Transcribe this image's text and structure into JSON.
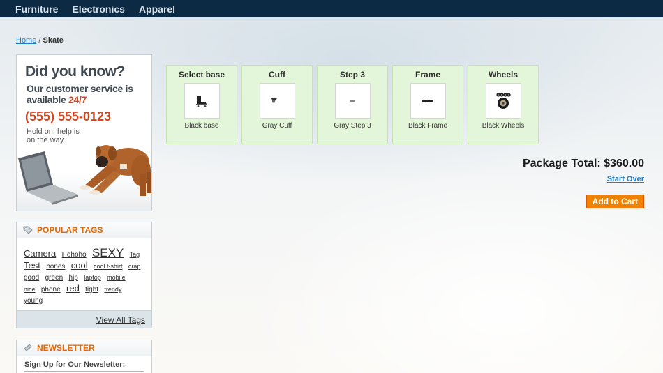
{
  "nav": {
    "items": [
      "Furniture",
      "Electronics",
      "Apparel"
    ]
  },
  "breadcrumb": {
    "home": "Home",
    "separator": " / ",
    "current": "Skate"
  },
  "callout": {
    "title": "Did you know?",
    "line1": "Our customer service is",
    "line2_prefix": "available ",
    "line2_highlight": "24/7",
    "phone": "(555) 555-0123",
    "hold": "Hold on, help is on the way."
  },
  "tags_block": {
    "title": "POPULAR TAGS",
    "icon": "tag-icon",
    "tags": [
      {
        "label": "Camera",
        "size": 13
      },
      {
        "label": "Hohoho",
        "size": 10
      },
      {
        "label": "SEXY",
        "size": 17
      },
      {
        "label": "Tag",
        "size": 9
      },
      {
        "label": "Test",
        "size": 13
      },
      {
        "label": "bones",
        "size": 10
      },
      {
        "label": "cool",
        "size": 13
      },
      {
        "label": "cool t-shirt",
        "size": 9
      },
      {
        "label": "crap",
        "size": 9
      },
      {
        "label": "good",
        "size": 10
      },
      {
        "label": "green",
        "size": 10
      },
      {
        "label": "hip",
        "size": 10
      },
      {
        "label": "laptop",
        "size": 9
      },
      {
        "label": "mobile",
        "size": 9
      },
      {
        "label": "nice",
        "size": 9
      },
      {
        "label": "phone",
        "size": 10
      },
      {
        "label": "red",
        "size": 13
      },
      {
        "label": "tight",
        "size": 10
      },
      {
        "label": "trendy",
        "size": 9
      },
      {
        "label": "young",
        "size": 10
      }
    ],
    "view_all": "View All Tags"
  },
  "newsletter": {
    "title": "NEWSLETTER",
    "icon": "newsletter-icon",
    "label": "Sign Up for Our Newsletter:"
  },
  "bundle": {
    "steps": [
      {
        "title": "Select base",
        "name": "Black base",
        "icon": "skate-base-icon"
      },
      {
        "title": "Cuff",
        "name": "Gray Cuff",
        "icon": "cuff-icon"
      },
      {
        "title": "Step 3",
        "name": "Gray Step 3",
        "icon": "step3-icon"
      },
      {
        "title": "Frame",
        "name": "Black Frame",
        "icon": "frame-icon"
      },
      {
        "title": "Wheels",
        "name": "Black Wheels",
        "icon": "wheels-icon"
      }
    ],
    "total": "Package Total: $360.00",
    "start_over": "Start Over",
    "add_to_cart": "Add to Cart"
  },
  "colors": {
    "nav_bg": "#0c2a44",
    "accent_orange": "#e26703",
    "button_orange": "#f18200",
    "link_blue": "#1e7ec8",
    "step_bg": "#e4f6d9",
    "phone_red": "#d2461f"
  }
}
